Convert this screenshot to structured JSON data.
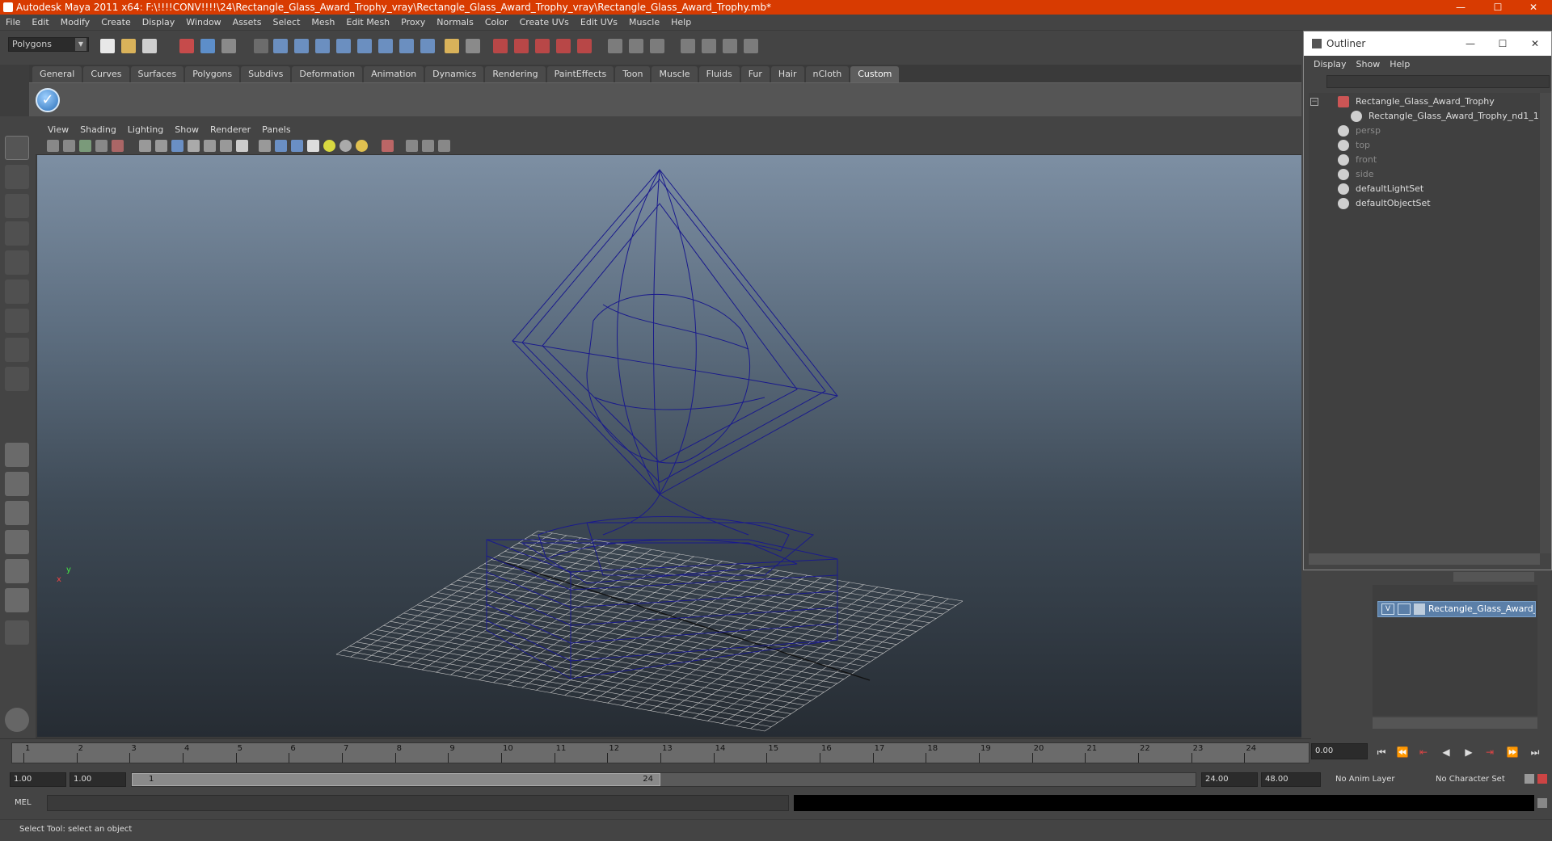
{
  "window": {
    "title": "Autodesk Maya 2011 x64: F:\\!!!!CONV!!!!\\24\\Rectangle_Glass_Award_Trophy_vray\\Rectangle_Glass_Award_Trophy_vray\\Rectangle_Glass_Award_Trophy.mb*",
    "minimize": "—",
    "maximize": "☐",
    "close": "✕"
  },
  "menubar": [
    "File",
    "Edit",
    "Modify",
    "Create",
    "Display",
    "Window",
    "Assets",
    "Select",
    "Mesh",
    "Edit Mesh",
    "Proxy",
    "Normals",
    "Color",
    "Create UVs",
    "Edit UVs",
    "Muscle",
    "Help"
  ],
  "statusline": {
    "mode": "Polygons"
  },
  "shelf": {
    "tabs": [
      "General",
      "Curves",
      "Surfaces",
      "Polygons",
      "Subdivs",
      "Deformation",
      "Animation",
      "Dynamics",
      "Rendering",
      "PaintEffects",
      "Toon",
      "Muscle",
      "Fluids",
      "Fur",
      "Hair",
      "nCloth",
      "Custom"
    ],
    "active_tab": "Custom",
    "check_glyph": "✓"
  },
  "panel": {
    "menu": [
      "View",
      "Shading",
      "Lighting",
      "Show",
      "Renderer",
      "Panels"
    ],
    "axis_x": "x",
    "axis_y": "y"
  },
  "timeline": {
    "ticks": [
      "1",
      "2",
      "3",
      "4",
      "5",
      "6",
      "7",
      "8",
      "9",
      "10",
      "11",
      "12",
      "13",
      "14",
      "15",
      "16",
      "17",
      "18",
      "19",
      "20",
      "21",
      "22",
      "23",
      "24"
    ],
    "current_time": "0.00",
    "playback": [
      "⏮",
      "⏪",
      "⇤",
      "◀",
      "▶",
      "⇥",
      "⏩",
      "⏭"
    ]
  },
  "range": {
    "start_time": "1.00",
    "playback_start": "1.00",
    "handle_start": "1",
    "handle_end": "24",
    "playback_end": "24.00",
    "end_time": "48.00",
    "anim_layer": "No Anim Layer",
    "character_set": "No Character Set"
  },
  "cmdline": {
    "label": "MEL"
  },
  "helpline": {
    "text": "Select Tool: select an object"
  },
  "outliner": {
    "title": "Outliner",
    "menu": [
      "Display",
      "Show",
      "Help"
    ],
    "items": [
      {
        "label": "Rectangle_Glass_Award_Trophy",
        "dim": false
      },
      {
        "label": "Rectangle_Glass_Award_Trophy_nd1_1",
        "dim": false
      },
      {
        "label": "persp",
        "dim": true
      },
      {
        "label": "top",
        "dim": true
      },
      {
        "label": "front",
        "dim": true
      },
      {
        "label": "side",
        "dim": true
      },
      {
        "label": "defaultLightSet",
        "dim": false
      },
      {
        "label": "defaultObjectSet",
        "dim": false
      }
    ]
  },
  "layers": {
    "row": {
      "visible": "V",
      "name": "Rectangle_Glass_Award_"
    }
  },
  "colors": {
    "titlebar": "#d83b01",
    "wireframe": "#1a1a8c",
    "grid": "#c8c8c8",
    "layer_selected": "#5b7fa8"
  }
}
